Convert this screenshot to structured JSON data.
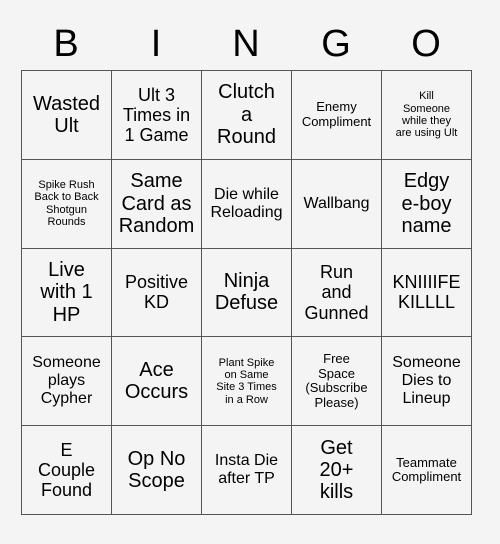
{
  "card": {
    "title": "BINGO",
    "header_letters": [
      "B",
      "I",
      "N",
      "G",
      "O"
    ],
    "colors": {
      "page_background": "#f4f4f4",
      "cell_background": "#f4f4f4",
      "grid_line": "#555555",
      "text": "#000000"
    },
    "grid": {
      "columns": 5,
      "rows": 5,
      "free_space_index": 17
    },
    "cells": [
      {
        "text": "Wasted\nUlt",
        "size": "fs-xl"
      },
      {
        "text": "Ult 3\nTimes in\n1 Game",
        "size": "fs-lg"
      },
      {
        "text": "Clutch\na\nRound",
        "size": "fs-xl"
      },
      {
        "text": "Enemy\nCompliment",
        "size": "fs-sm"
      },
      {
        "text": "Kill\nSomeone\nwhile they\nare using Ult",
        "size": "fs-xs"
      },
      {
        "text": "Spike Rush\nBack to Back\nShotgun\nRounds",
        "size": "fs-xs"
      },
      {
        "text": "Same\nCard as\nRandom",
        "size": "fs-xl"
      },
      {
        "text": "Die while\nReloading",
        "size": "fs-md"
      },
      {
        "text": "Wallbang",
        "size": "fs-md"
      },
      {
        "text": "Edgy\ne-boy\nname",
        "size": "fs-xl"
      },
      {
        "text": "Live\nwith 1\nHP",
        "size": "fs-xl"
      },
      {
        "text": "Positive\nKD",
        "size": "fs-lg"
      },
      {
        "text": "Ninja\nDefuse",
        "size": "fs-xl"
      },
      {
        "text": "Run\nand\nGunned",
        "size": "fs-lg"
      },
      {
        "text": "KNIIIIFE\nKILLLL",
        "size": "fs-lg"
      },
      {
        "text": "Someone\nplays\nCypher",
        "size": "fs-md"
      },
      {
        "text": "Ace\nOccurs",
        "size": "fs-xl"
      },
      {
        "text": "Plant Spike\non Same\nSite 3 Times\nin a Row",
        "size": "fs-xs"
      },
      {
        "text": "Free\nSpace\n(Subscribe\nPlease)",
        "size": "fs-sm"
      },
      {
        "text": "Someone\nDies to\nLineup",
        "size": "fs-md"
      },
      {
        "text": "E\nCouple\nFound",
        "size": "fs-lg"
      },
      {
        "text": "Op No\nScope",
        "size": "fs-xl"
      },
      {
        "text": "Insta Die\nafter TP",
        "size": "fs-md"
      },
      {
        "text": "Get\n20+\nkills",
        "size": "fs-xl"
      },
      {
        "text": "Teammate\nCompliment",
        "size": "fs-sm"
      }
    ]
  }
}
